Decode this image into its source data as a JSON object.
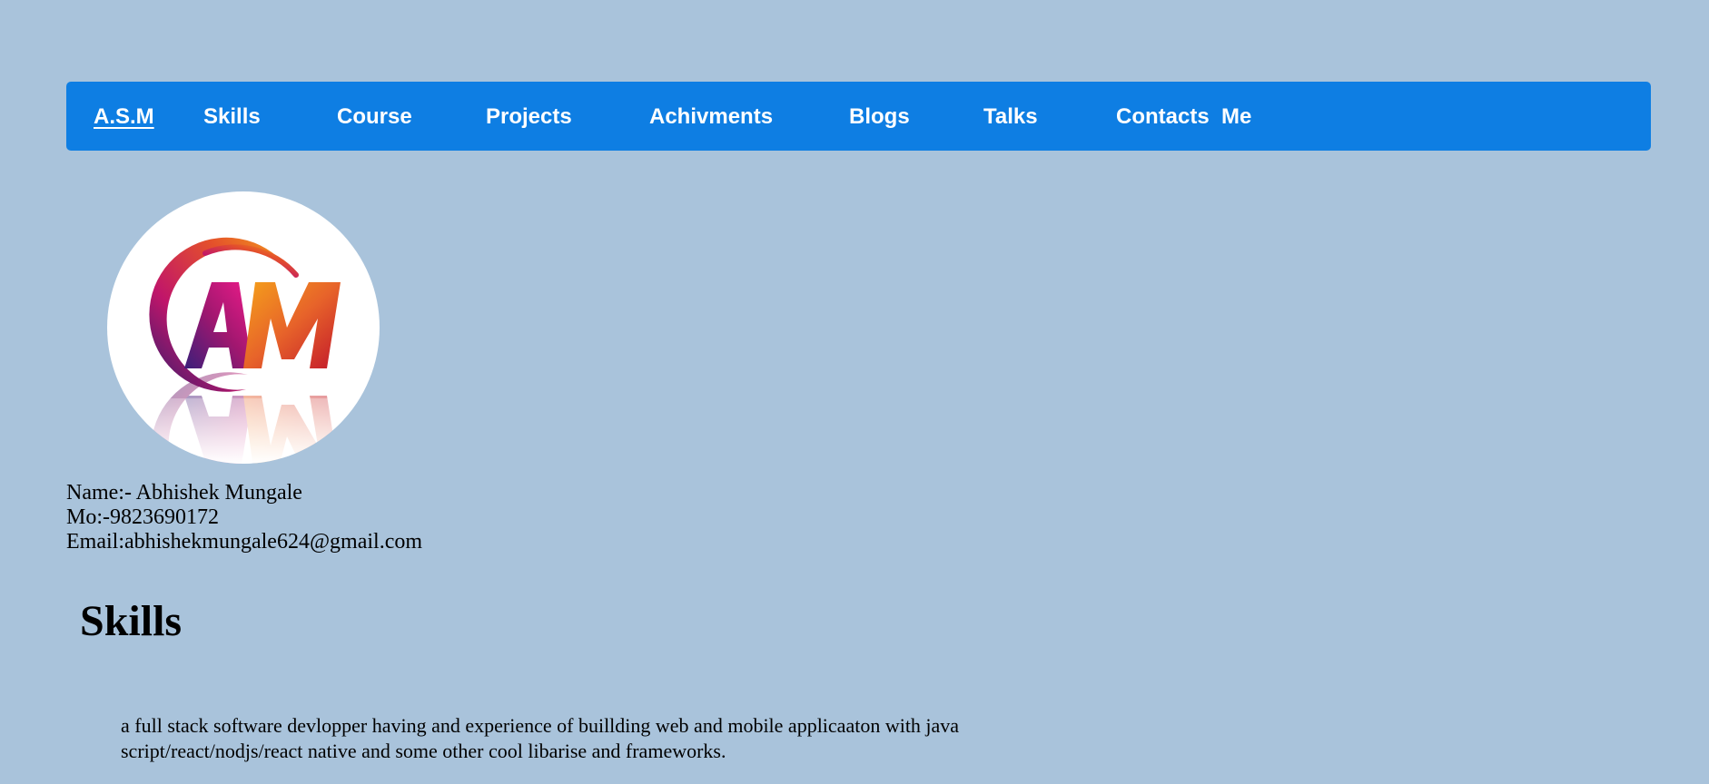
{
  "nav": {
    "brand": "A.S.M",
    "items": [
      {
        "label": "Skills"
      },
      {
        "label": "Course"
      },
      {
        "label": "Projects"
      },
      {
        "label": "Achivments"
      },
      {
        "label": "Blogs"
      },
      {
        "label": "Talks"
      },
      {
        "label": "Contacts  Me"
      }
    ]
  },
  "profile": {
    "logo_text": "AM",
    "logo_icon": "am-logo",
    "name": "Name:- Abhishek Mungale",
    "mobile": "Mo:-9823690172",
    "email": "Email:abhishekmungale624@gmail.com"
  },
  "skills": {
    "title": "Skills",
    "description": "a full stack software devlopper having and experience of buillding web and mobile applicaaton with java script/react/nodjs/react native and some other cool libarise and frameworks."
  },
  "colors": {
    "background": "#a9c3db",
    "navbar": "#0e7ee3",
    "nav_text": "#ffffff"
  }
}
